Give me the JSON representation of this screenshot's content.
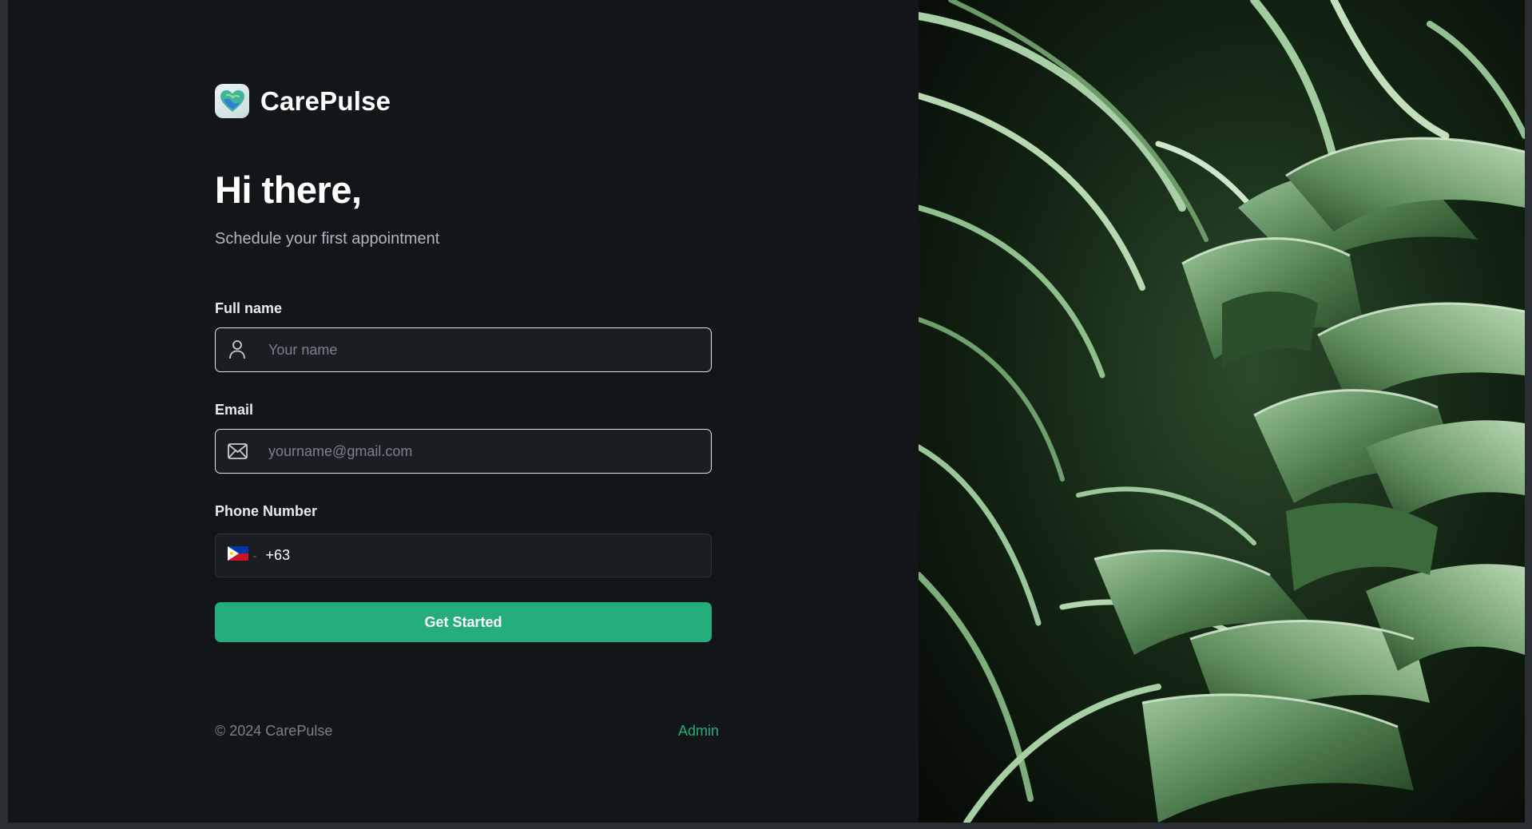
{
  "brand": {
    "name": "CarePulse",
    "accent": "#24ae7c"
  },
  "hero": {
    "title": "Hi there,",
    "subtitle": "Schedule your first appointment"
  },
  "form": {
    "full_name": {
      "label": "Full name",
      "placeholder": "Your name",
      "value": "",
      "icon": "user-icon"
    },
    "email": {
      "label": "Email",
      "placeholder": "yourname@gmail.com",
      "value": "",
      "icon": "mail-icon"
    },
    "phone": {
      "label": "Phone Number",
      "country": "Philippines",
      "flag_icon": "ph-flag-icon",
      "value": "+63"
    },
    "submit_label": "Get Started"
  },
  "footer": {
    "copyright": "© 2024 CarePulse",
    "admin_link": "Admin"
  },
  "colors": {
    "background": "#131619",
    "input_bg": "#1a1d21",
    "primary_button": "#24ae7c",
    "muted_text": "#76828d"
  }
}
